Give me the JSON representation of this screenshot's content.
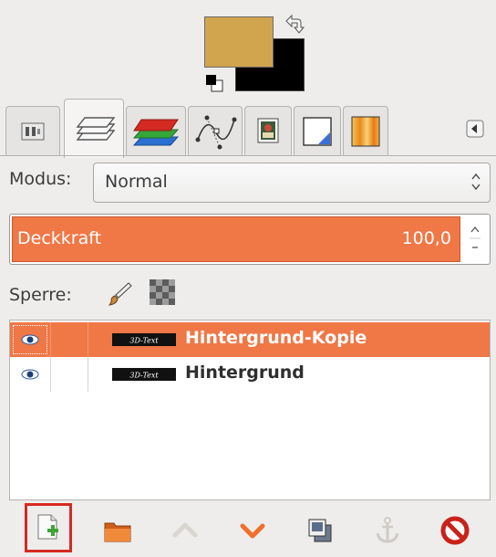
{
  "colors": {
    "foreground": "#d1a54e",
    "background": "#000000",
    "accent": "#f07746",
    "highlight_box": "#d42a22"
  },
  "tabs": [
    {
      "icon": "tool-options-icon",
      "active": false
    },
    {
      "icon": "layers-icon",
      "active": true
    },
    {
      "icon": "channels-icon",
      "active": false
    },
    {
      "icon": "paths-icon",
      "active": false
    },
    {
      "icon": "colormap-icon",
      "active": false
    },
    {
      "icon": "histogram-icon",
      "active": false
    },
    {
      "icon": "gradients-icon",
      "active": false
    }
  ],
  "mode": {
    "label": "Modus:",
    "value": "Normal"
  },
  "opacity": {
    "label": "Deckkraft",
    "value": "100,0",
    "fraction": 1.0
  },
  "lock": {
    "label": "Sperre:"
  },
  "layers": [
    {
      "name": "Hintergrund-Kopie",
      "thumb_text": "3D-Text",
      "visible": true,
      "selected": true
    },
    {
      "name": "Hintergrund",
      "thumb_text": "3D-Text",
      "visible": true,
      "selected": false
    }
  ],
  "toolbar": [
    {
      "icon": "new-layer-icon",
      "highlighted": true
    },
    {
      "icon": "new-layer-group-icon",
      "highlighted": false
    },
    {
      "icon": "raise-layer-icon",
      "highlighted": false
    },
    {
      "icon": "lower-layer-icon",
      "highlighted": false
    },
    {
      "icon": "duplicate-layer-icon",
      "highlighted": false
    },
    {
      "icon": "anchor-layer-icon",
      "highlighted": false
    },
    {
      "icon": "delete-layer-icon",
      "highlighted": false
    }
  ]
}
